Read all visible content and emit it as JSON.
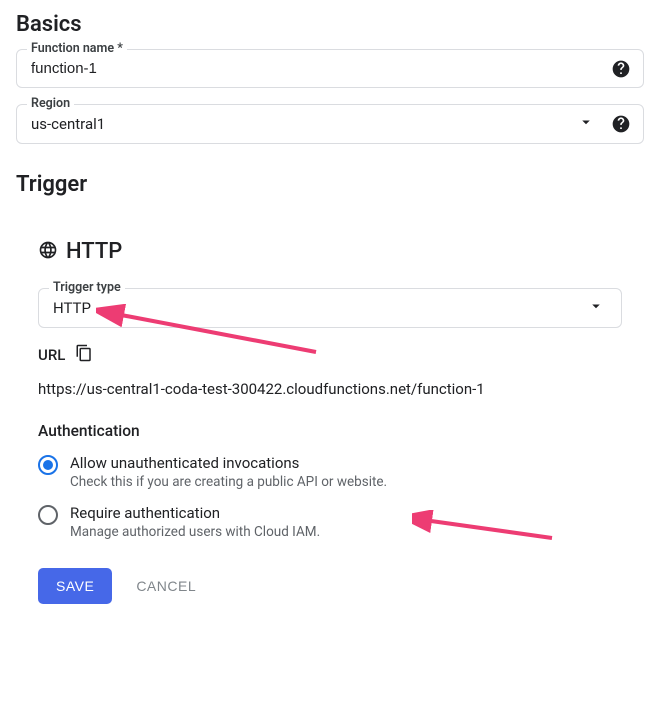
{
  "basics": {
    "title": "Basics",
    "function_name_label": "Function name *",
    "function_name_value": "function-1",
    "region_label": "Region",
    "region_value": "us-central1"
  },
  "trigger": {
    "title": "Trigger",
    "http_heading": "HTTP",
    "trigger_type_label": "Trigger type",
    "trigger_type_value": "HTTP",
    "url_label": "URL",
    "url_value": "https://us-central1-coda-test-300422.cloudfunctions.net/function-1",
    "auth_heading": "Authentication",
    "auth_options": [
      {
        "label": "Allow unauthenticated invocations",
        "desc": "Check this if you are creating a public API or website.",
        "selected": true
      },
      {
        "label": "Require authentication",
        "desc": "Manage authorized users with Cloud IAM.",
        "selected": false
      }
    ],
    "save_label": "SAVE",
    "cancel_label": "CANCEL"
  }
}
